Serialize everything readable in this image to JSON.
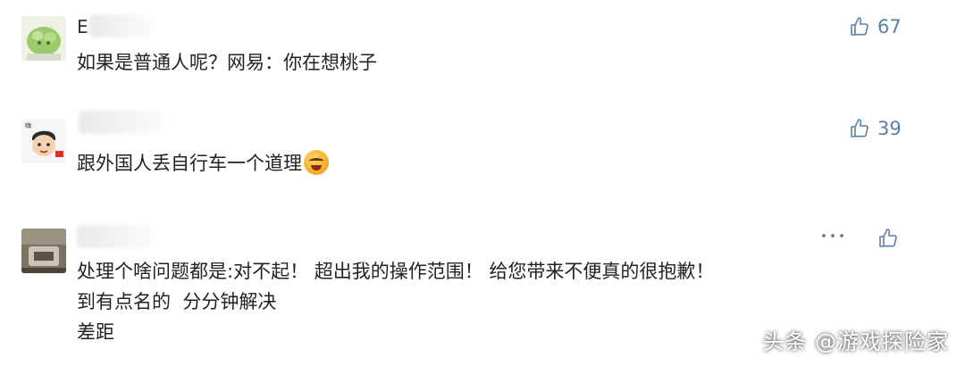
{
  "comments": [
    {
      "name_fragment": "E",
      "text": "如果是普通人呢？网易：你在想桃子",
      "likes": "67"
    },
    {
      "text": "跟外国人丢自行车一个道理",
      "likes": "39"
    },
    {
      "lines": [
        "处理个啥问题都是:对不起！ 超出我的操作范围！ 给您带来不便真的很抱歉！",
        "到有点名的  分分钟解决",
        "差距"
      ]
    }
  ],
  "icons": {
    "like": "thumbs-up-icon",
    "more": "more-options-icon",
    "emoji": "grimace-emoji-icon"
  },
  "colors": {
    "like_accent": "#5b7fa8"
  },
  "watermark": "头条 @游戏探险家"
}
